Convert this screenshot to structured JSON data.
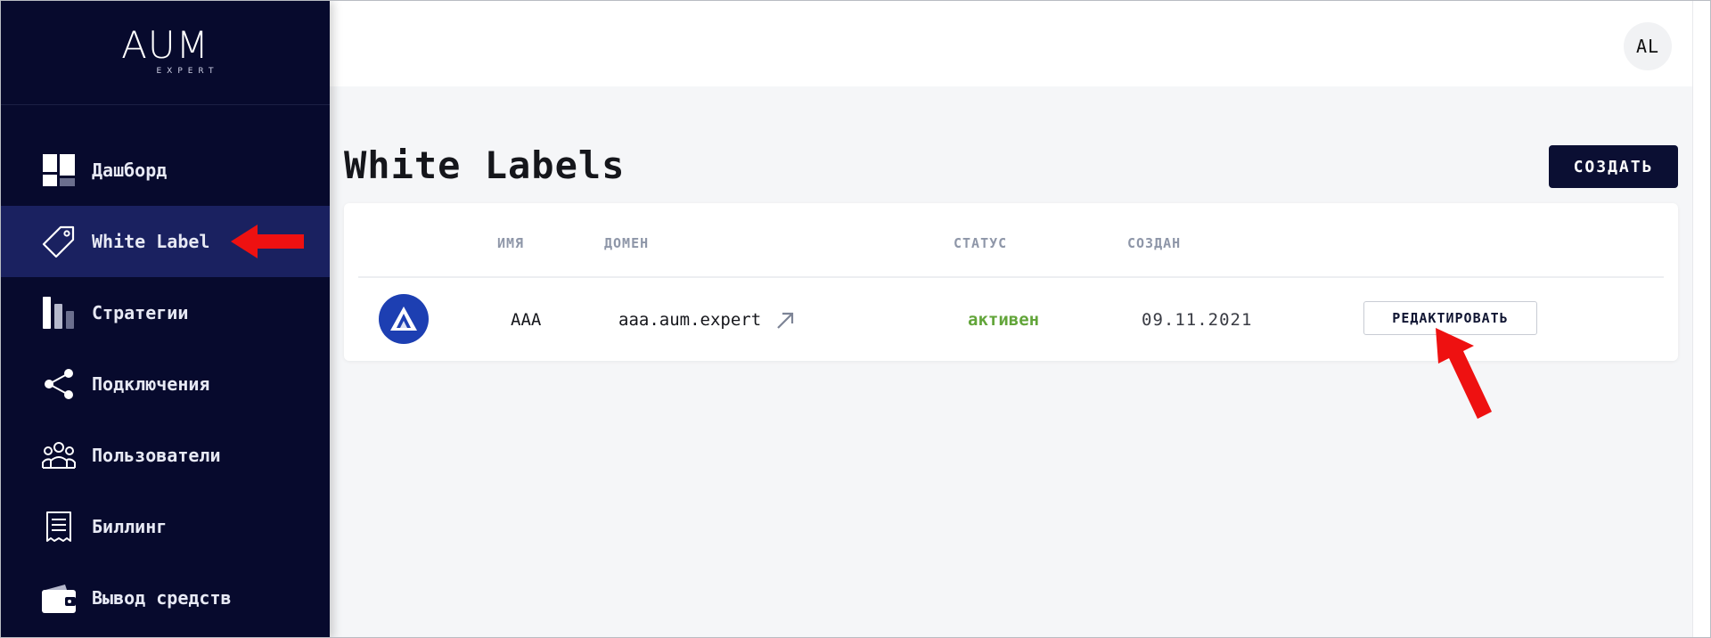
{
  "app": {
    "logo_main": "AUM",
    "logo_sub": "EXPERT"
  },
  "sidebar": {
    "items": [
      {
        "label": "Дашборд",
        "icon": "dashboard-icon"
      },
      {
        "label": "White Label",
        "icon": "tag-icon",
        "active": true
      },
      {
        "label": "Стратегии",
        "icon": "strategies-icon"
      },
      {
        "label": "Подключения",
        "icon": "share-icon"
      },
      {
        "label": "Пользователи",
        "icon": "users-icon"
      },
      {
        "label": "Биллинг",
        "icon": "receipt-icon"
      },
      {
        "label": "Вывод средств",
        "icon": "wallet-icon"
      }
    ]
  },
  "header": {
    "avatar_initials": "AL"
  },
  "main": {
    "title": "White Labels",
    "create_label": "СОЗДАТЬ",
    "table": {
      "columns": [
        "ИМЯ",
        "ДОМЕН",
        "СТАТУС",
        "СОЗДАН"
      ],
      "rows": [
        {
          "logo": "triangle-logo-icon",
          "name": "AAA",
          "domain": "aaa.aum.expert",
          "status": "активен",
          "created": "09.11.2021",
          "edit_label": "РЕДАКТИРОВАТЬ"
        }
      ]
    }
  },
  "colors": {
    "sidebar_bg": "#070a2d",
    "sidebar_active": "#1a2160",
    "primary_button": "#0b0f33",
    "status_active": "#62a53a",
    "annotation_arrow": "#ee1111"
  }
}
